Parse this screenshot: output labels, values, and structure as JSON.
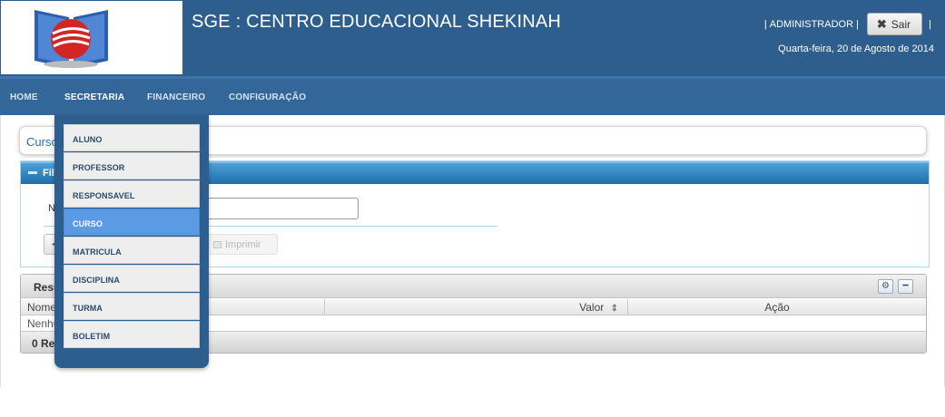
{
  "header": {
    "title": "SGE : CENTRO EDUCACIONAL SHEKINAH",
    "user_sep_left": "|",
    "user": "ADMINISTRADOR",
    "user_sep_right": "|",
    "sair_label": "Sair",
    "trailing_sep": "|",
    "date": "Quarta-feira, 20 de Agosto de 2014"
  },
  "nav": {
    "items": [
      {
        "label": "HOME"
      },
      {
        "label": "SECRETARIA"
      },
      {
        "label": "FINANCEIRO"
      },
      {
        "label": "CONFIGURAÇÃO"
      }
    ],
    "active": "SECRETARIA"
  },
  "dropdown": {
    "items": [
      {
        "label": "ALUNO"
      },
      {
        "label": "PROFESSOR"
      },
      {
        "label": "RESPONSAVEL"
      },
      {
        "label": "CURSO"
      },
      {
        "label": "MATRICULA"
      },
      {
        "label": "DISCIPLINA"
      },
      {
        "label": "TURMA"
      },
      {
        "label": "BOLETIM"
      }
    ],
    "active": "CURSO"
  },
  "breadcrumb": {
    "text": "Curso"
  },
  "filter": {
    "title": "Filtro",
    "nome_label": "Nome",
    "nome_value": "",
    "imprimir_label": "Imprimir"
  },
  "results": {
    "title": "Resultados",
    "columns": [
      "Nome",
      "Valor",
      "Ação"
    ],
    "sort_icon": "sort-icon",
    "empty_message": "Nenhum registro encontrado.",
    "footer": "0 Registros"
  },
  "colors": {
    "header_bg": "#2d5e8e",
    "nav_bg": "#336699",
    "menu_active": "#5b9be6",
    "filter_header": "#1d6fae"
  }
}
